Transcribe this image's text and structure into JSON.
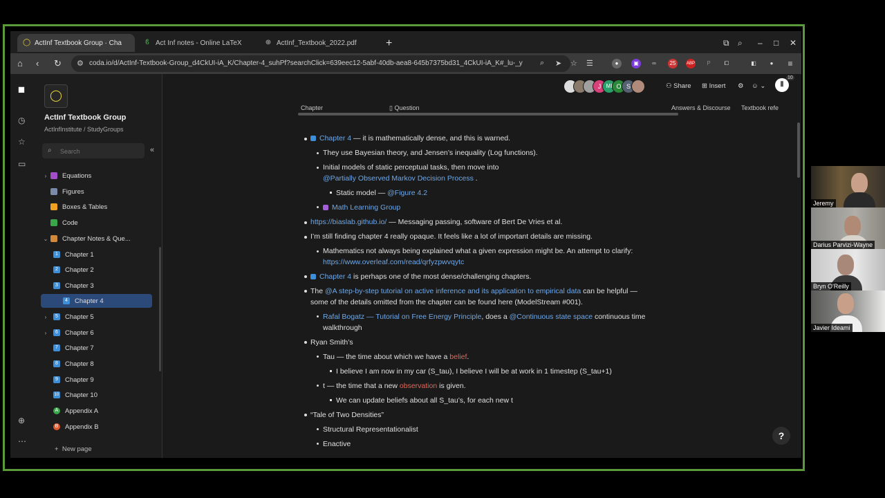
{
  "browser": {
    "tabs": [
      {
        "title": "ActInf Textbook Group · Cha",
        "active": true
      },
      {
        "title": "Act Inf notes - Online LaTeX",
        "active": false
      },
      {
        "title": "ActInf_Textbook_2022.pdf",
        "active": false
      }
    ],
    "url": "coda.io/d/ActInf-Textbook-Group_d4CkUI-iA_K/Chapter-4_suhPf?searchClick=639eec12-5abf-40db-aea8-645b7375bd31_4CkUI-iA_K#_lu-_y",
    "extension_badge": "25"
  },
  "sidebar": {
    "doc_title": "ActInf Textbook Group",
    "doc_subtitle": "ActInfInstitute / StudyGroups",
    "search_placeholder": "Search",
    "items": [
      {
        "label": "Equations",
        "color": "#a34fc9"
      },
      {
        "label": "Figures",
        "color": "#7a8aa8"
      },
      {
        "label": "Boxes & Tables",
        "color": "#f0a020"
      },
      {
        "label": "Code",
        "color": "#3aa84a"
      },
      {
        "label": "Chapter Notes & Que...",
        "color": "#d08a3a"
      },
      {
        "label": "Chapter 1",
        "color": "#3f8fd8",
        "num": "1"
      },
      {
        "label": "Chapter 2",
        "color": "#3f8fd8",
        "num": "2"
      },
      {
        "label": "Chapter 3",
        "color": "#3f8fd8",
        "num": "3"
      },
      {
        "label": "Chapter 4",
        "color": "#3f8fd8",
        "num": "4"
      },
      {
        "label": "Chapter 5",
        "color": "#3f8fd8",
        "num": "5"
      },
      {
        "label": "Chapter 6",
        "color": "#3f8fd8",
        "num": "6"
      },
      {
        "label": "Chapter 7",
        "color": "#3f8fd8",
        "num": "7"
      },
      {
        "label": "Chapter 8",
        "color": "#3f8fd8",
        "num": "8"
      },
      {
        "label": "Chapter 9",
        "color": "#3f8fd8",
        "num": "9"
      },
      {
        "label": "Chapter 10",
        "color": "#3f8fd8",
        "num": "10"
      },
      {
        "label": "Appendix A",
        "color": "#3aa84a",
        "num": "A"
      },
      {
        "label": "Appendix B",
        "color": "#e05a30",
        "num": "B"
      }
    ],
    "new_page": "New page"
  },
  "toolbar": {
    "share": "Share",
    "insert": "Insert",
    "avatar_letters": [
      "J",
      "MI",
      "O",
      "S"
    ],
    "user_count": "10"
  },
  "columns": {
    "chapter": "Chapter",
    "question": "Question",
    "answers": "Answers & Discourse",
    "textbook": "Textbook refe"
  },
  "notes": {
    "l1_link": "Chapter 4",
    "l1_rest": " — it is mathematically dense, and this is warned.",
    "l2": "They use Bayesian theory, and Jensen’s inequality (Log functions).",
    "l3": "Initial models of static perceptual tasks, then move into",
    "l3b": "@Partially Observed Markov Decision Process",
    "l3c": " .",
    "l4_pre": "Static model — ",
    "l4_link": "@Figure 4.2",
    "l5": "Math Learning Group",
    "l6_link": "https://biaslab.github.io/",
    "l6_rest": " — Messaging passing, software of Bert De Vries et al.",
    "l7": "I’m still finding chapter 4 really opaque. It feels like a lot of important details are missing.",
    "l8": "Mathematics not always being explained what a given expression might be.  An attempt to clarify:",
    "l8b": "https://www.overleaf.com/read/qrfyzpwvqytc",
    "l9_link": "Chapter 4",
    "l9_rest": " is perhaps one of the most dense/challenging chapters.",
    "l10_pre": "The ",
    "l10_link": "@A step-by-step tutorial on active inference and its application to empirical data",
    "l10_rest": " can be helpful —",
    "l10b": "some of the details omitted from the chapter can be found here (ModelStream #001).",
    "l11_link": "Rafal Bogatz — Tutorial on Free Energy Principle",
    "l11_mid": ", does a ",
    "l11_link2": "@Continuous state space",
    "l11_rest": " continuous time",
    "l11b": "walkthrough",
    "l12": "Ryan Smith’s",
    "l13_pre": "Tau — the time about which we have a ",
    "l13_red": "belief",
    "l13_post": ".",
    "l14": "I believe I am now in my car (S_tau), I believe I will be at work in 1 timestep (S_tau+1)",
    "l15_pre": "t — the time that a new ",
    "l15_red": "observation",
    "l15_post": " is given.",
    "l16": "We can update beliefs about all S_tau’s, for each new t",
    "l17": "“Tale of Two Densities”",
    "l18": "Structural Representationalist",
    "l19": "Enactive"
  },
  "participants": [
    "Jeremy",
    "Darius Parvizi-Wayne",
    "Bryn O'Reilly",
    "Javier Ideami"
  ]
}
